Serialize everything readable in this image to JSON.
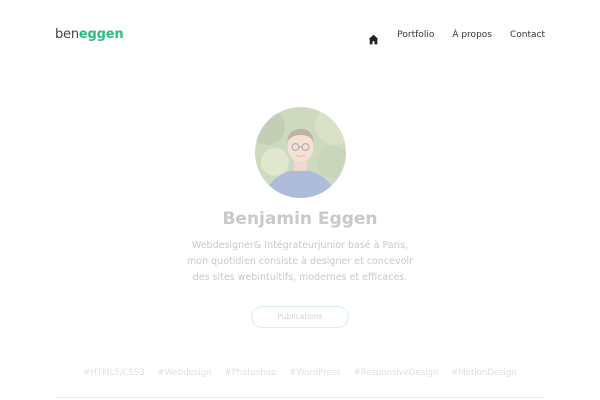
{
  "logo": {
    "first": "ben",
    "second": "eggen"
  },
  "nav": {
    "home_icon": "home-icon",
    "items": [
      {
        "label": "Portfolio"
      },
      {
        "label": "À propos"
      },
      {
        "label": "Contact"
      }
    ]
  },
  "hero": {
    "name": "Benjamin Eggen",
    "bio_lines": [
      "Webdesigner& Intégrateurjunior basé à Paris,",
      "mon quotidien consiste à designer et concevoir",
      "des sites webintuitifs, modernes et efficaces."
    ],
    "button_label": "Publications"
  },
  "tags": [
    "#HTML5/CSS3",
    "#Webdesign",
    "#Photoshop",
    "#WordPress",
    "#ResponsiveDesign",
    "#MotionDesign"
  ],
  "colors": {
    "brand_green": "#2bbf7e",
    "text_dark": "#333333",
    "faded_text": "#c9c9c9"
  }
}
